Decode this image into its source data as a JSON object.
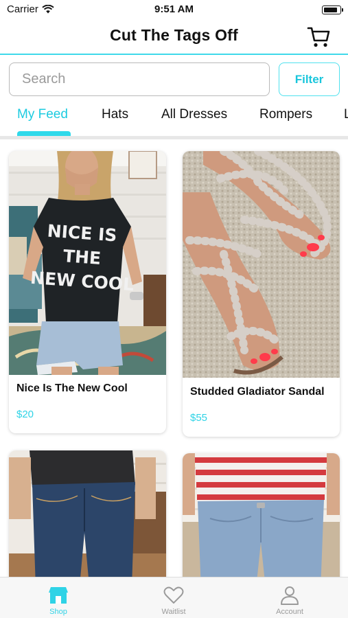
{
  "status_bar": {
    "carrier": "Carrier",
    "time": "9:51 AM",
    "battery_level": 0.9
  },
  "header": {
    "title": "Cut The Tags Off",
    "cart_icon": "cart-icon"
  },
  "search": {
    "placeholder": "Search",
    "value": "",
    "filter_label": "Filter"
  },
  "tabs": [
    {
      "label": "My Feed",
      "active": true
    },
    {
      "label": "Hats",
      "active": false
    },
    {
      "label": "All Dresses",
      "active": false
    },
    {
      "label": "Rompers",
      "active": false
    },
    {
      "label": "L",
      "active": false
    }
  ],
  "products": [
    {
      "name": "Nice Is The New Cool",
      "price": "$20",
      "shirt_text": "NICE IS THE NEW COOL",
      "image": "model in black graphic tee"
    },
    {
      "name": "Studded Gladiator Sandal",
      "price": "$55",
      "image": "studded gladiator sandals"
    },
    {
      "name": "",
      "price": "",
      "image": "dark wash jeans"
    },
    {
      "name": "",
      "price": "",
      "image": "striped top with light jeans"
    }
  ],
  "tab_bar": [
    {
      "label": "Shop",
      "icon": "shop-icon",
      "active": true
    },
    {
      "label": "Waitlist",
      "icon": "heart-icon",
      "active": false
    },
    {
      "label": "Account",
      "icon": "account-icon",
      "active": false
    }
  ],
  "colors": {
    "accent": "#2fd3e6",
    "header_rule": "#3fd9ea",
    "inactive": "#9a9a9a"
  }
}
